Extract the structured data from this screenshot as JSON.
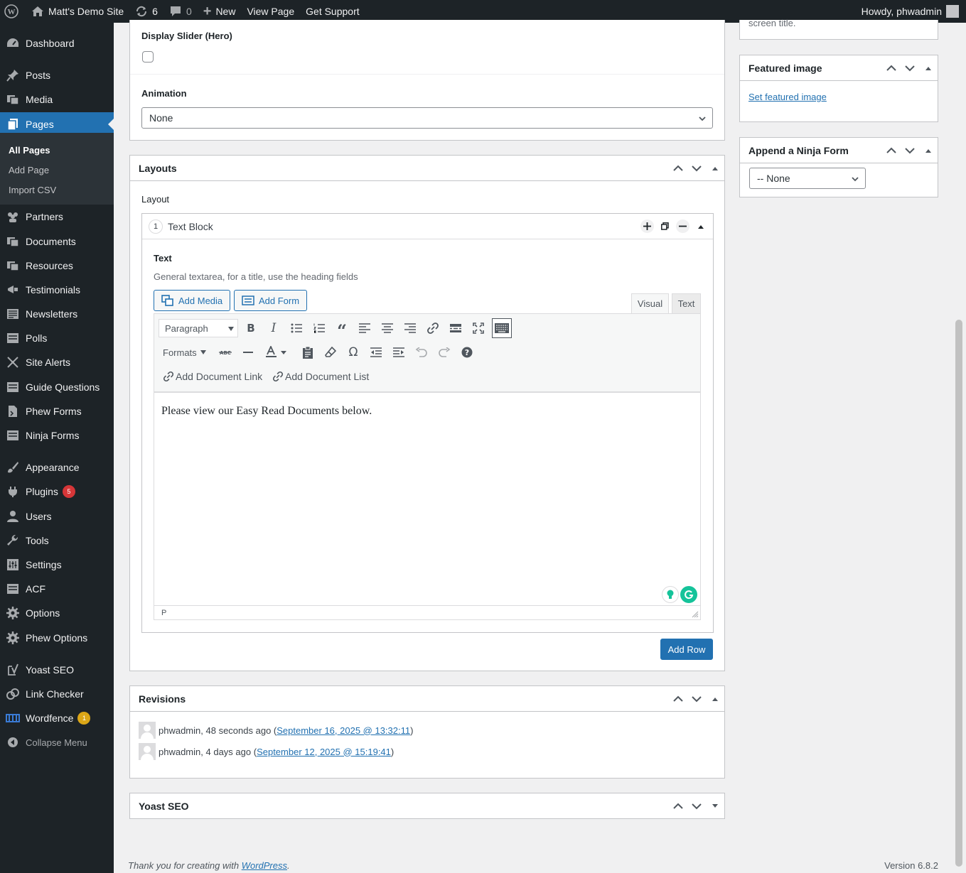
{
  "adminbar": {
    "site_name": "Matt's Demo Site",
    "updates_count": "6",
    "comments_count": "0",
    "new_label": "New",
    "view_page_label": "View Page",
    "support_label": "Get Support",
    "howdy": "Howdy, phwadmin"
  },
  "sidebar": {
    "items": {
      "dashboard": "Dashboard",
      "posts": "Posts",
      "media": "Media",
      "pages": "Pages",
      "partners": "Partners",
      "documents": "Documents",
      "resources": "Resources",
      "testimonials": "Testimonials",
      "newsletters": "Newsletters",
      "polls": "Polls",
      "site_alerts": "Site Alerts",
      "guide_questions": "Guide Questions",
      "phew_forms": "Phew Forms",
      "ninja_forms": "Ninja Forms",
      "appearance": "Appearance",
      "plugins": "Plugins",
      "users": "Users",
      "tools": "Tools",
      "settings": "Settings",
      "acf": "ACF",
      "options": "Options",
      "phew_options": "Phew Options",
      "yoast": "Yoast SEO",
      "link_checker": "Link Checker",
      "wordfence": "Wordfence",
      "collapse": "Collapse Menu"
    },
    "submenu": {
      "all_pages": "All Pages",
      "add_page": "Add Page",
      "import_csv": "Import CSV"
    },
    "badges": {
      "plugins": "5",
      "wordfence": "1"
    }
  },
  "hero": {
    "display_slider_label": "Display Slider (Hero)",
    "animation_label": "Animation",
    "animation_value": "None"
  },
  "layouts": {
    "title": "Layouts",
    "layout_label": "Layout",
    "row_number": "1",
    "row_title": "Text Block",
    "text_label": "Text",
    "text_instructions": "General textarea, for a title, use the heading fields",
    "add_media": "Add Media",
    "add_form": "Add Form",
    "tab_visual": "Visual",
    "tab_text": "Text",
    "format_select": "Paragraph",
    "formats_label": "Formats",
    "add_doc_link": "Add Document Link",
    "add_doc_list": "Add Document List",
    "content": "Please view our Easy Read Documents below.",
    "path": "P",
    "add_row": "Add Row"
  },
  "revisions": {
    "title": "Revisions",
    "rows": [
      {
        "author": "phwadmin",
        "ago": "48 seconds ago",
        "date": "September 16, 2025 @ 13:32:11"
      },
      {
        "author": "phwadmin",
        "ago": "4 days ago",
        "date": "September 12, 2025 @ 15:19:41"
      }
    ]
  },
  "yoast_panel": {
    "title": "Yoast SEO"
  },
  "right_col": {
    "cut_text": "screen title.",
    "featured_title": "Featured image",
    "set_featured": "Set featured image",
    "ninja_title": "Append a Ninja Form",
    "ninja_value": "-- None"
  },
  "footer": {
    "thanks": "Thank you for creating with ",
    "wp_link": "WordPress",
    "period": ".",
    "version": "Version 6.8.2"
  },
  "colors": {
    "accent": "#2271b1",
    "sidebar_bg": "#1d2327",
    "page_bg": "#f0f0f1",
    "badge_red": "#d63638",
    "badge_yellow": "#dba617"
  }
}
